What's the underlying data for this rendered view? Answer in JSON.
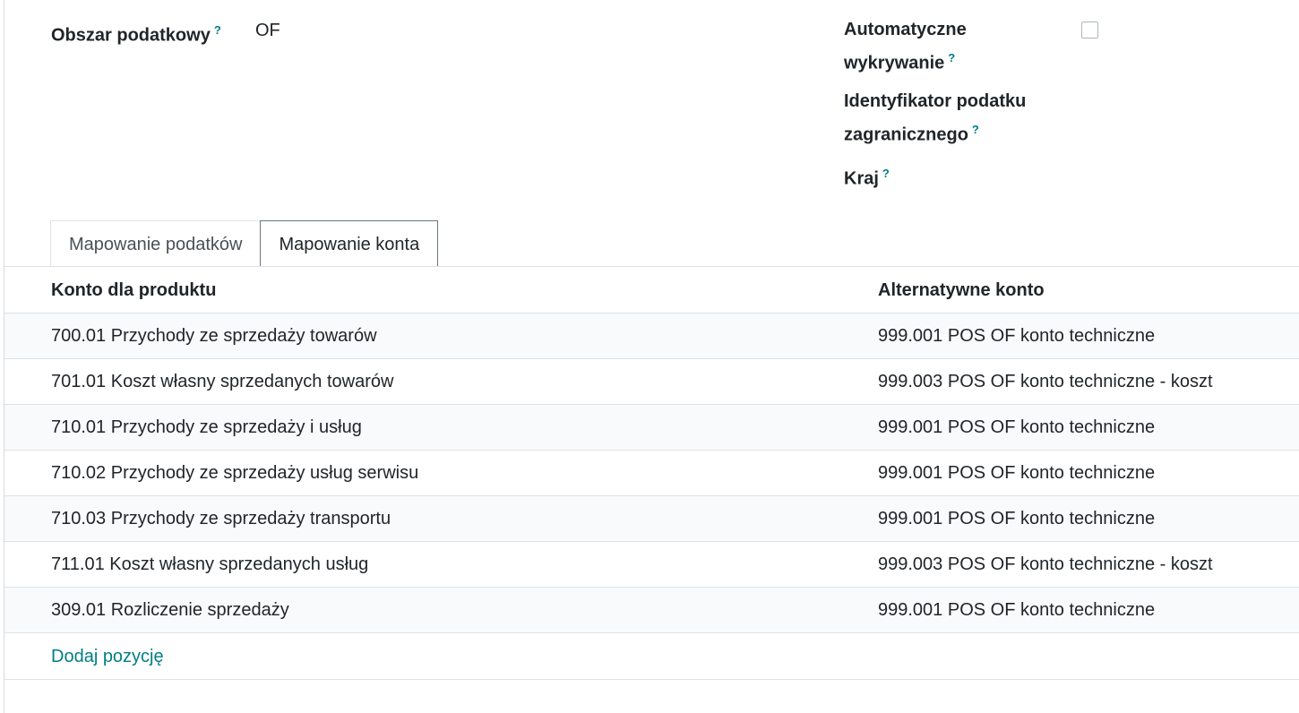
{
  "form": {
    "fiscal_area_label": "Obszar podatkowy",
    "fiscal_area_value": "OF",
    "auto_detect_label_line1": "Automatyczne",
    "auto_detect_label_line2": "wykrywanie",
    "auto_detect_checked": false,
    "foreign_vat_label_line1": "Identyfikator podatku",
    "foreign_vat_label_line2": "zagranicznego",
    "country_label": "Kraj",
    "help_mark": "?"
  },
  "tabs": [
    {
      "label": "Mapowanie podatków",
      "active": false
    },
    {
      "label": "Mapowanie konta",
      "active": true
    }
  ],
  "table": {
    "columns": [
      "Konto dla produktu",
      "Alternatywne konto"
    ],
    "rows": [
      {
        "source": "700.01 Przychody ze sprzedaży towarów",
        "dest": "999.001 POS OF konto techniczne"
      },
      {
        "source": "701.01 Koszt własny sprzedanych towarów",
        "dest": "999.003 POS OF konto techniczne - koszt"
      },
      {
        "source": "710.01 Przychody ze sprzedaży i usług",
        "dest": "999.001 POS OF konto techniczne"
      },
      {
        "source": "710.02 Przychody ze sprzedaży usług serwisu",
        "dest": "999.001 POS OF konto techniczne"
      },
      {
        "source": "710.03 Przychody ze sprzedaży transportu",
        "dest": "999.001 POS OF konto techniczne"
      },
      {
        "source": "711.01 Koszt własny sprzedanych usług",
        "dest": "999.003 POS OF konto techniczne - koszt"
      },
      {
        "source": "309.01 Rozliczenie sprzedaży",
        "dest": "999.001 POS OF konto techniczne"
      }
    ],
    "add_line_label": "Dodaj pozycję"
  },
  "colors": {
    "accent": "#017e84",
    "row_alt": "#f9fafb",
    "border": "#dee2e6"
  }
}
